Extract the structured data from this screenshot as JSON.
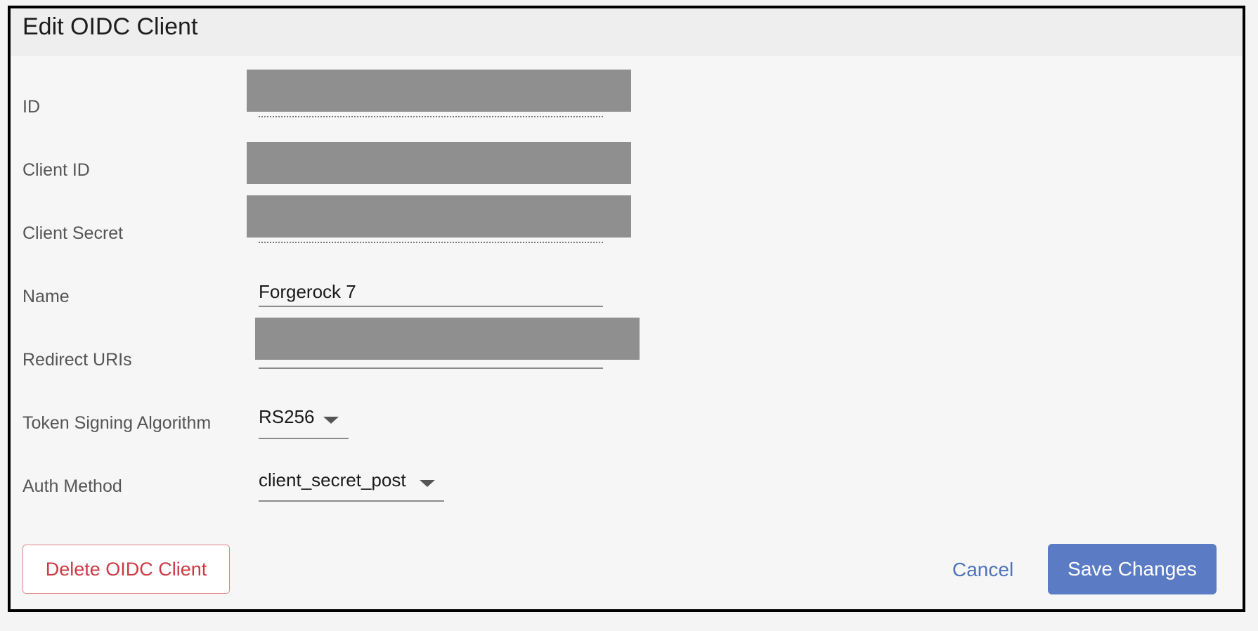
{
  "dialog": {
    "title": "Edit OIDC Client"
  },
  "fields": {
    "id": {
      "label": "ID",
      "value": ""
    },
    "client_id": {
      "label": "Client ID",
      "value": ""
    },
    "client_secret": {
      "label": "Client Secret",
      "value": ""
    },
    "name": {
      "label": "Name",
      "value": "Forgerock 7"
    },
    "redirect_uris": {
      "label": "Redirect URIs",
      "value": ""
    },
    "token_signing_algorithm": {
      "label": "Token Signing Algorithm",
      "value": "RS256"
    },
    "auth_method": {
      "label": "Auth Method",
      "value": "client_secret_post"
    }
  },
  "actions": {
    "delete_label": "Delete OIDC Client",
    "cancel_label": "Cancel",
    "save_label": "Save Changes"
  },
  "colors": {
    "primary": "#5b7bc4",
    "danger": "#cc3a44",
    "redaction": "#8f8f8f"
  }
}
